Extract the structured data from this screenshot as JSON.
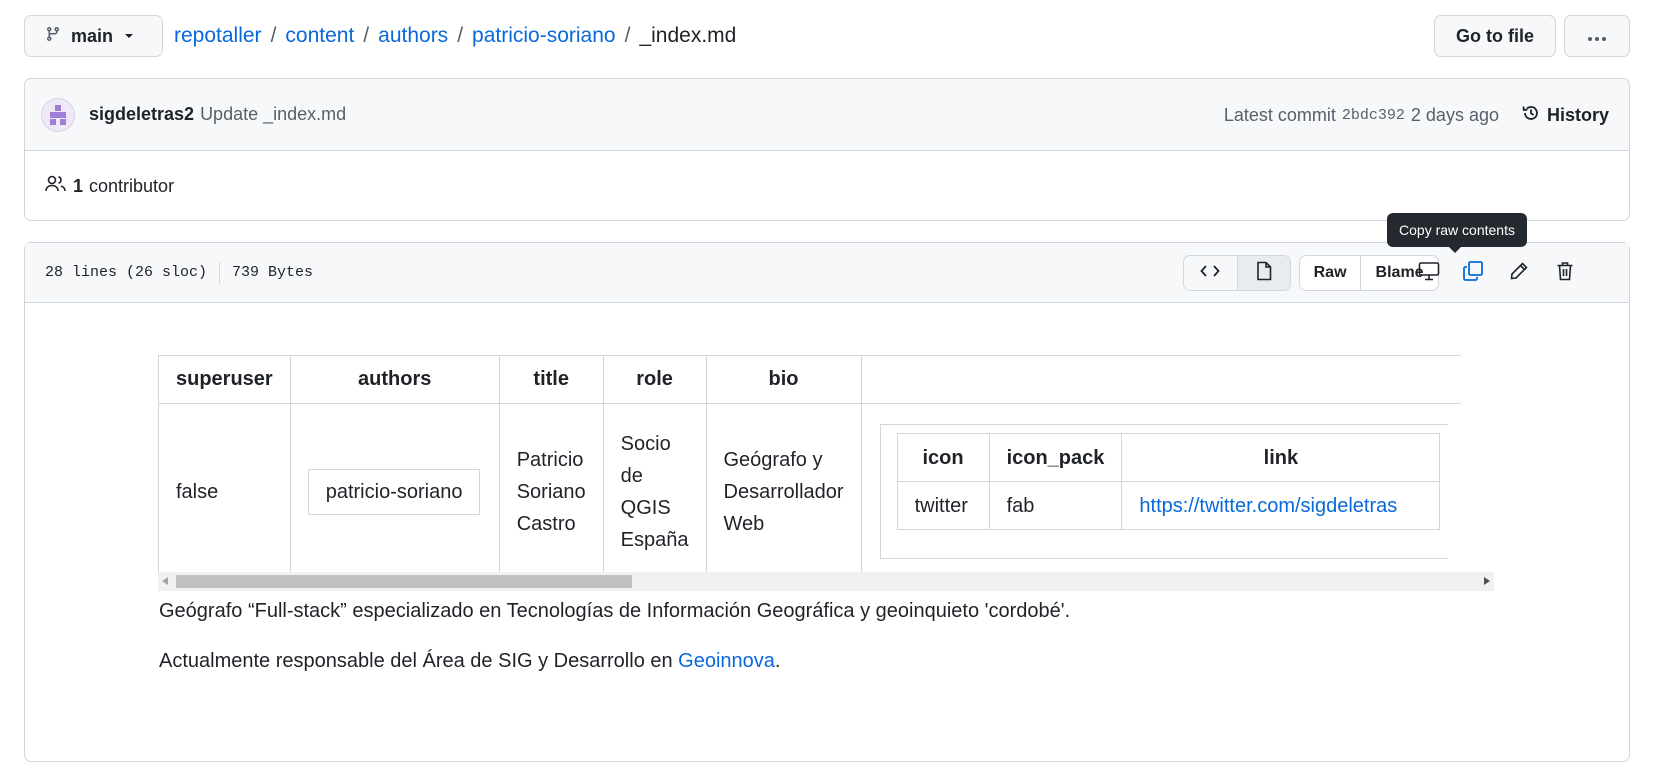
{
  "topbar": {
    "branch_label": "main",
    "breadcrumb": [
      "repotaller",
      "content",
      "authors",
      "patricio-soriano"
    ],
    "current_file": "_index.md",
    "goto_label": "Go to file"
  },
  "commit": {
    "author": "sigdeletras2",
    "message": "Update _index.md",
    "latest_label": "Latest commit",
    "sha": "2bdc392",
    "time": "2 days ago",
    "history_label": "History"
  },
  "contributors": {
    "count": "1",
    "label": "contributor"
  },
  "file": {
    "lines": "28 lines (26 sloc)",
    "size": "739 Bytes",
    "raw_label": "Raw",
    "blame_label": "Blame",
    "tooltip": "Copy raw contents"
  },
  "frontmatter": {
    "headers": [
      "superuser",
      "authors",
      "title",
      "role",
      "bio"
    ],
    "superuser": "false",
    "author": "patricio-soriano",
    "title_lines": [
      "Patricio",
      "Soriano",
      "Castro"
    ],
    "role_lines": [
      "Socio",
      "de",
      "QGIS",
      "España"
    ],
    "bio_lines": [
      "Geógrafo y",
      "Desarrollador",
      "Web"
    ],
    "social": {
      "headers": [
        "icon",
        "icon_pack",
        "link"
      ],
      "icon": "twitter",
      "icon_pack": "fab",
      "link": "https://twitter.com/sigdeletras"
    }
  },
  "content": {
    "p1": "Geógrafo “Full-stack” especializado en Tecnologías de Información Geográfica y geoinquieto 'cordobé'.",
    "p2_prefix": "Actualmente responsable del Área de SIG y Desarrollo en ",
    "p2_link": "Geoinnova",
    "p2_suffix": "."
  },
  "colors": {
    "link": "#0969da",
    "border": "#d0d7de",
    "header_bg": "#f6f8fa",
    "tooltip_bg": "#24292f",
    "accent_icon": "#0969da"
  }
}
